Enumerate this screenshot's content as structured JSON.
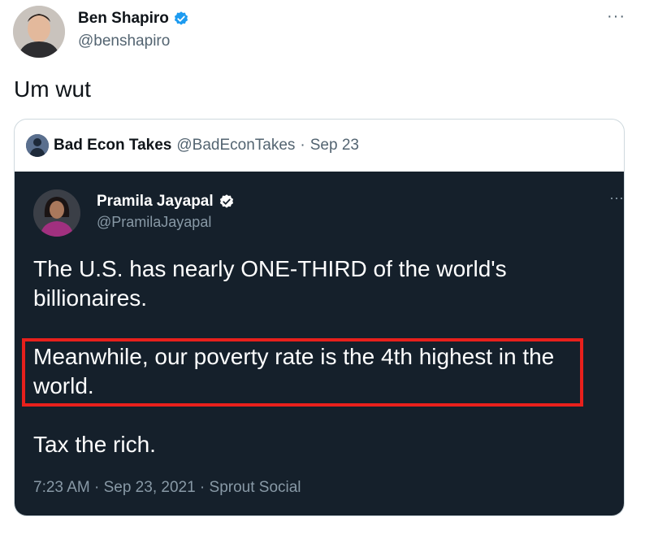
{
  "tweet": {
    "display_name": "Ben Shapiro",
    "handle": "@benshapiro",
    "text": "Um wut",
    "more_label": "···",
    "verified": true
  },
  "quoted": {
    "display_name": "Bad Econ Takes",
    "handle": "@BadEconTakes",
    "separator": "·",
    "date": "Sep 23",
    "embedded_tweet": {
      "display_name": "Pramila Jayapal",
      "handle": "@PramilaJayapal",
      "verified": true,
      "more_label": "···",
      "paragraph1": "The U.S. has nearly ONE-THIRD of the world's billionaires.",
      "paragraph2": "Meanwhile, our poverty rate is the 4th highest in the world.",
      "paragraph3": "Tax the rich.",
      "footer": "7:23 AM · Sep 23, 2021 · Sprout Social"
    }
  },
  "colors": {
    "verified_badge": "#1d9bf0",
    "dark_background": "#15202b",
    "highlight_box": "#e8201c"
  }
}
